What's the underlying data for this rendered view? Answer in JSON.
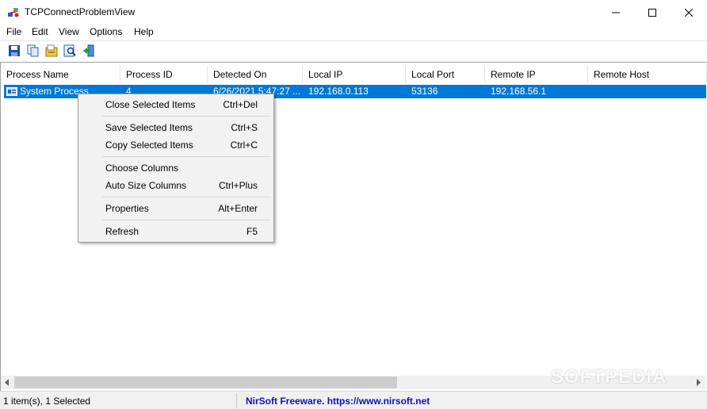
{
  "window": {
    "title": "TCPConnectProblemView",
    "app_icon": "network-plug-icon"
  },
  "menu": [
    "File",
    "Edit",
    "View",
    "Options",
    "Help"
  ],
  "toolbar": {
    "icons": [
      "save-icon",
      "copy-icon",
      "properties-icon",
      "find-icon",
      "exit-icon"
    ]
  },
  "table": {
    "columns": [
      "Process Name",
      "Process ID",
      "Detected On",
      "Local IP",
      "Local Port",
      "Remote IP",
      "Remote Host"
    ],
    "rows": [
      [
        "System Process",
        "4",
        "6/26/2021 5:47:27 ...",
        "192.168.0.113",
        "53136",
        "192.168.56.1",
        ""
      ]
    ]
  },
  "context_menu": {
    "items": [
      {
        "label": "Close Selected Items",
        "accel": "Ctrl+Del"
      },
      {
        "label": "Save Selected Items",
        "accel": "Ctrl+S"
      },
      {
        "label": "Copy Selected Items",
        "accel": "Ctrl+C"
      },
      {
        "label": "Choose Columns",
        "accel": ""
      },
      {
        "label": "Auto Size Columns",
        "accel": "Ctrl+Plus"
      },
      {
        "label": "Properties",
        "accel": "Alt+Enter"
      },
      {
        "label": "Refresh",
        "accel": "F5"
      }
    ]
  },
  "status": {
    "count": "1 item(s), 1 Selected",
    "link": "NirSoft Freeware. https://www.nirsoft.net"
  },
  "watermark": "SOFTPEDIA",
  "colors": {
    "selection": "#0078d7",
    "link": "#1010b8"
  }
}
